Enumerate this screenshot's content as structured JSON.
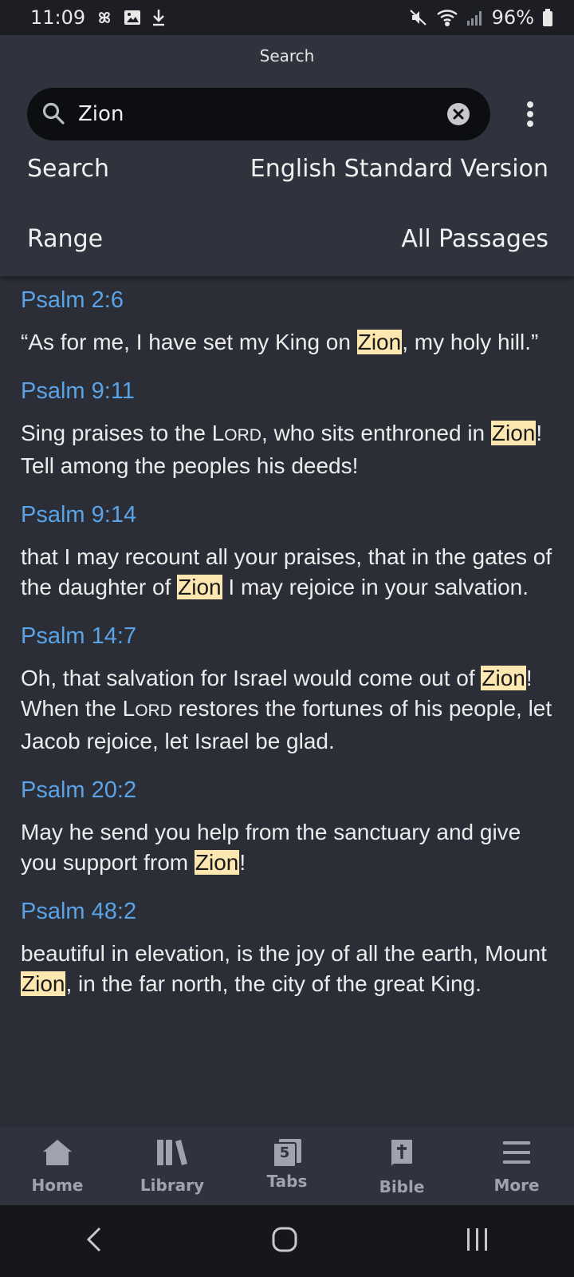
{
  "status_bar": {
    "time": "11:09",
    "battery": "96%"
  },
  "header": {
    "title": "Search",
    "search": {
      "value": "Zion",
      "placeholder": ""
    },
    "search_label": "Search",
    "search_value": "English Standard Version",
    "range_label": "Range",
    "range_value": "All Passages"
  },
  "results": [
    {
      "ref": "Psalm 2:6",
      "parts": [
        {
          "t": "“As for me, I have set my King on "
        },
        {
          "t": "Zion",
          "hl": true
        },
        {
          "t": ", my holy hill.”"
        }
      ]
    },
    {
      "ref": "Psalm 9:11",
      "parts": [
        {
          "t": "Sing praises to the L"
        },
        {
          "t": "ord",
          "sc": true
        },
        {
          "t": ", who sits enthroned in "
        },
        {
          "t": "Zion",
          "hl": true
        },
        {
          "t": "! Tell among the peoples his deeds!"
        }
      ]
    },
    {
      "ref": "Psalm 9:14",
      "parts": [
        {
          "t": "that I may recount all your praises, that in the gates of the daughter of "
        },
        {
          "t": "Zion",
          "hl": true
        },
        {
          "t": " I may rejoice in your salvation."
        }
      ]
    },
    {
      "ref": "Psalm 14:7",
      "parts": [
        {
          "t": "Oh, that salvation for Israel would come out of "
        },
        {
          "t": "Zion",
          "hl": true
        },
        {
          "t": "! When the L"
        },
        {
          "t": "ord",
          "sc": true
        },
        {
          "t": " restores the fortunes of his people, let Jacob rejoice, let Israel be glad."
        }
      ]
    },
    {
      "ref": "Psalm 20:2",
      "parts": [
        {
          "t": "May he send you help from the sanctuary and give you support from "
        },
        {
          "t": "Zion",
          "hl": true
        },
        {
          "t": "!"
        }
      ]
    },
    {
      "ref": "Psalm 48:2",
      "parts": [
        {
          "t": "beautiful in elevation, is the joy of all the earth, Mount "
        },
        {
          "t": "Zion",
          "hl": true
        },
        {
          "t": ", in the far north, the city of the great King."
        }
      ]
    }
  ],
  "bottom_nav": [
    {
      "label": "Home",
      "icon": "home-icon"
    },
    {
      "label": "Library",
      "icon": "library-icon"
    },
    {
      "label": "Tabs",
      "icon": "tabs-icon",
      "badge": "5"
    },
    {
      "label": "Bible",
      "icon": "bible-icon"
    },
    {
      "label": "More",
      "icon": "menu-icon"
    }
  ],
  "colors": {
    "accent": "#5aa3e6",
    "highlight": "#fde7b0",
    "background": "#2b2e37"
  }
}
